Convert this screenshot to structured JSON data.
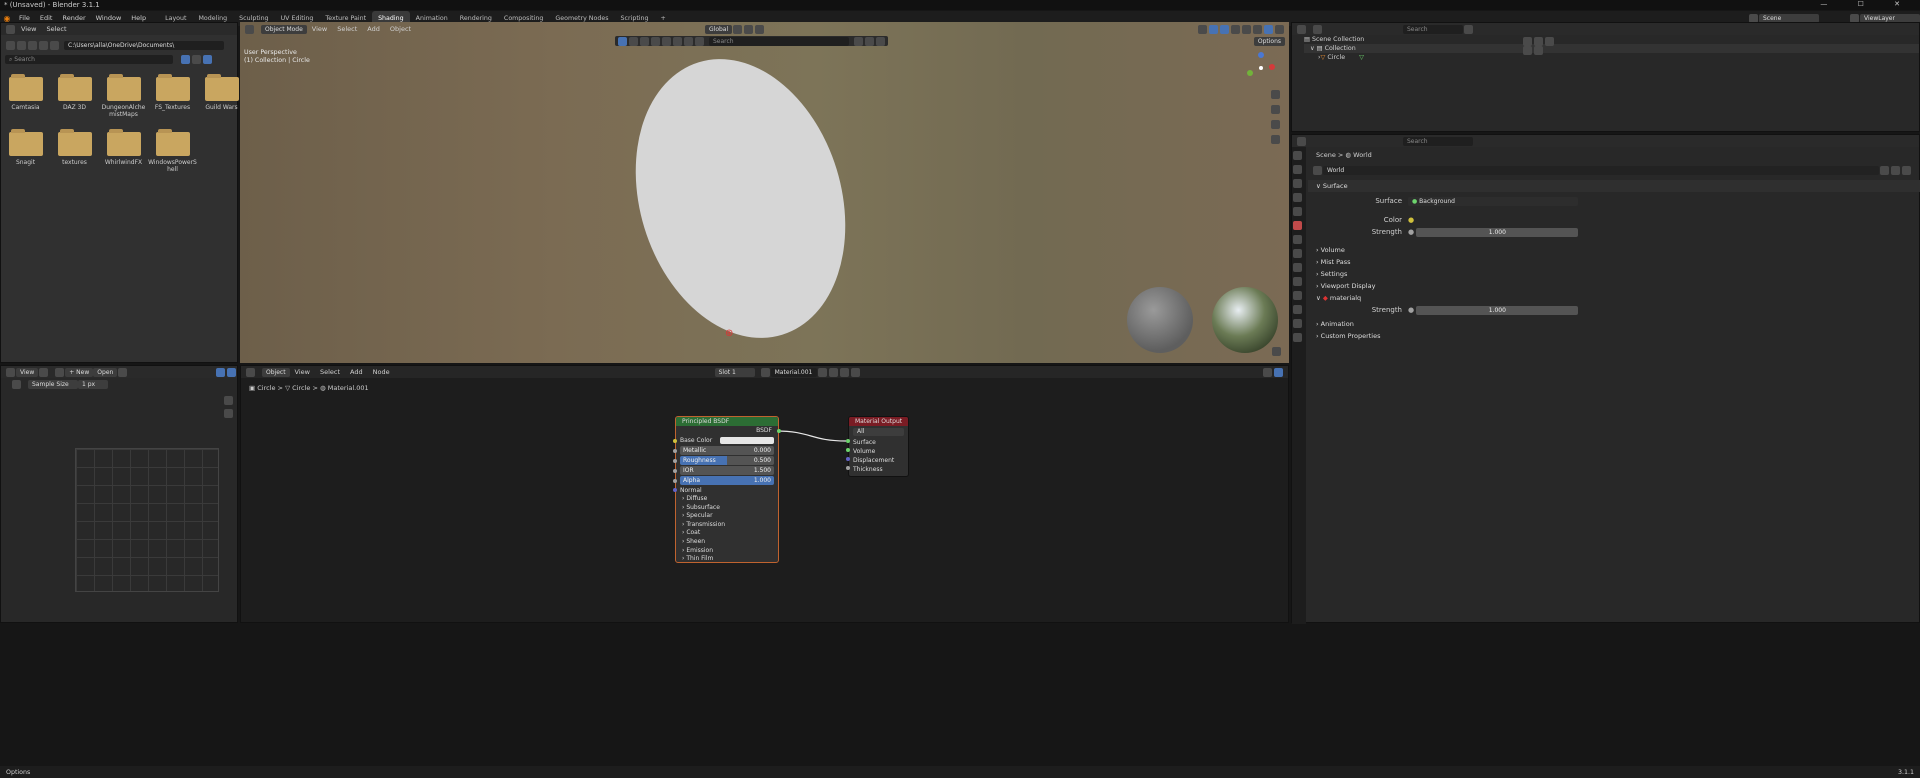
{
  "window": {
    "title": "* (Unsaved) - Blender 3.1.1"
  },
  "menus": [
    "File",
    "Edit",
    "Render",
    "Window",
    "Help"
  ],
  "workspaces": [
    "Layout",
    "Modeling",
    "Sculpting",
    "UV Editing",
    "Texture Paint",
    "Shading",
    "Animation",
    "Rendering",
    "Compositing",
    "Geometry Nodes",
    "Scripting"
  ],
  "active_workspace": "Shading",
  "top_right": {
    "scene": "Scene",
    "view_layer": "ViewLayer"
  },
  "file_browser": {
    "view": "View",
    "select": "Select",
    "path": "C:\\Users\\alla\\OneDrive\\Documents\\",
    "search_placeholder": "Search",
    "folders": [
      "Camtasia",
      "DAZ 3D",
      "DungeonAlchemistMaps",
      "FS_Textures",
      "Guild Wars",
      "Snagit",
      "textures",
      "WhirlwindFX",
      "WindowsPowerShell"
    ]
  },
  "viewport": {
    "mode": "Object Mode",
    "view": "View",
    "select": "Select",
    "add": "Add",
    "object": "Object",
    "orientation": "Global",
    "options": "Options",
    "overlay_line1": "User Perspective",
    "overlay_line2": "(1) Collection | Circle",
    "search_placeholder": "Search"
  },
  "image_editor": {
    "view": "View",
    "new": "New",
    "open": "Open",
    "sample_label": "Sample Size",
    "sample_value": "1 px"
  },
  "node_editor": {
    "object": "Object",
    "view": "View",
    "select": "Select",
    "add": "Add",
    "node": "Node",
    "slot": "Slot 1",
    "material": "Material.001",
    "breadcrumb": [
      "Circle",
      "Circle",
      "Material.001"
    ],
    "bsdf": {
      "title": "Principled BSDF",
      "output": "BSDF",
      "base_color": "Base Color",
      "rows": [
        {
          "label": "Metallic",
          "value": "0.000"
        },
        {
          "label": "Roughness",
          "value": "0.500"
        },
        {
          "label": "IOR",
          "value": "1.500"
        },
        {
          "label": "Alpha",
          "value": "1.000"
        }
      ],
      "normal": "Normal",
      "panels": [
        "Diffuse",
        "Subsurface",
        "Specular",
        "Transmission",
        "Coat",
        "Sheen",
        "Emission",
        "Thin Film"
      ]
    },
    "output": {
      "title": "Material Output",
      "target": "All",
      "sockets": [
        "Surface",
        "Volume",
        "Displacement",
        "Thickness"
      ]
    }
  },
  "outliner": {
    "search_placeholder": "Search",
    "scene_collection": "Scene Collection",
    "collection": "Collection",
    "circle": "Circle"
  },
  "properties": {
    "search_placeholder": "Search",
    "breadcrumb": [
      "Scene",
      "World"
    ],
    "world_name": "World",
    "surface": "Surface",
    "surface_label": "Surface",
    "surface_value": "Background",
    "color_label": "Color",
    "strength_label": "Strength",
    "strength_value": "1.000",
    "sections": [
      "Volume",
      "Mist Pass",
      "Settings",
      "Viewport Display"
    ],
    "lightgroup": "materialq",
    "lightgroup_strength_label": "Strength",
    "lightgroup_strength": "1.000",
    "tail_sections": [
      "Animation",
      "Custom Properties"
    ]
  },
  "status": {
    "left": "Options",
    "right": "3.1.1"
  },
  "colors": {
    "accent": "#4772b3",
    "bsdf_header": "#2c6d34",
    "output_header": "#7a1c24",
    "folder": "#c9a660"
  }
}
